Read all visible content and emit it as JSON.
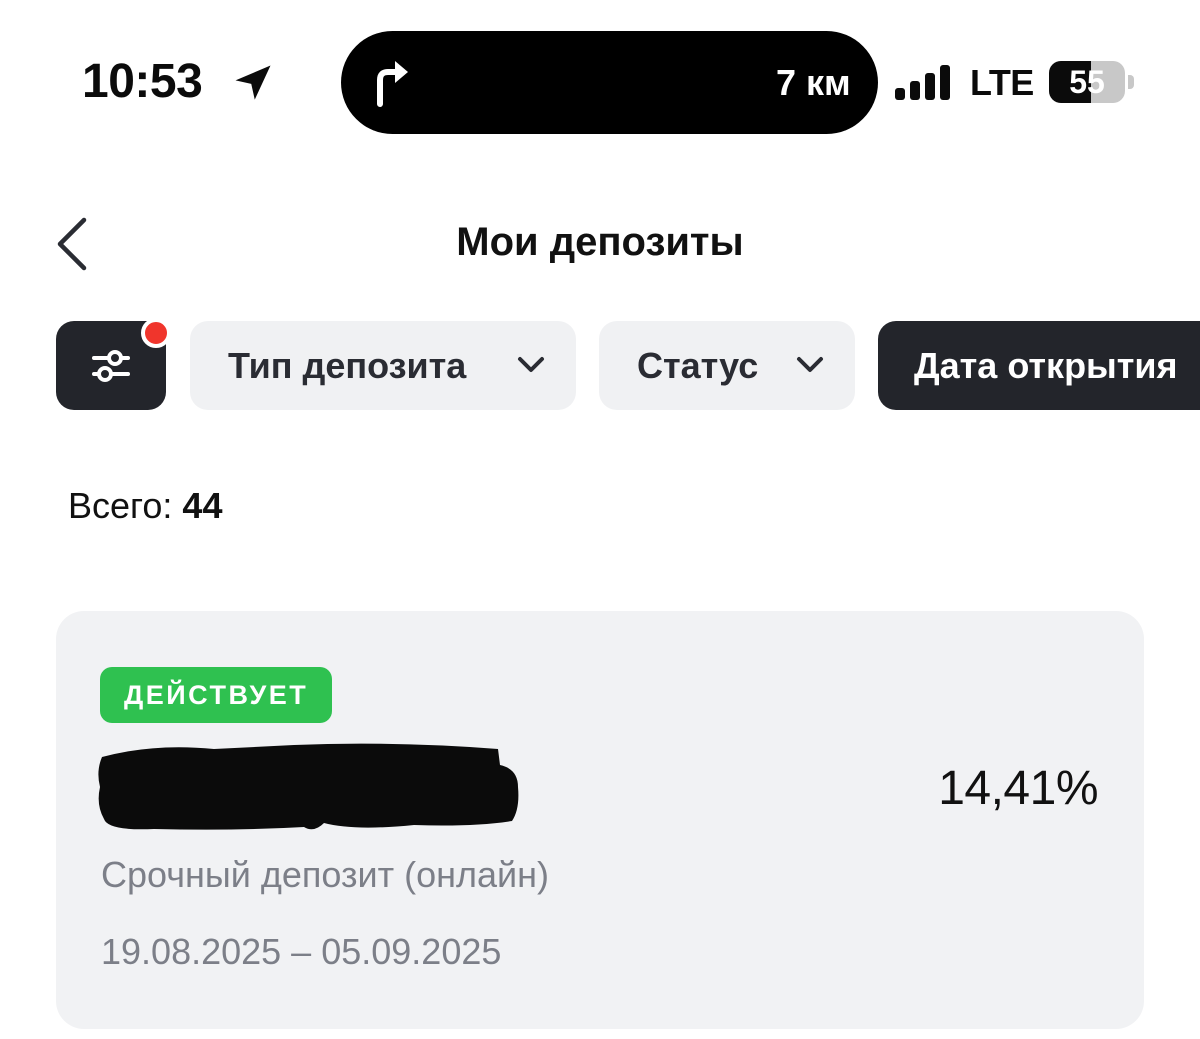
{
  "status_bar": {
    "time": "10:53",
    "location_icon": "location-arrow-icon",
    "navigation": {
      "icon": "turn-right-arrow-icon",
      "distance": "7 км"
    },
    "signal_icon": "cellular-signal-icon",
    "network": "LTE",
    "battery_level": "55",
    "battery_fraction": 0.55
  },
  "header": {
    "back_icon": "chevron-left-icon",
    "title": "Мои депозиты"
  },
  "filters": {
    "settings_icon": "sliders-icon",
    "has_notification_dot": true,
    "chips": [
      {
        "label": "Тип депозита",
        "icon": "chevron-down-icon",
        "selected": false
      },
      {
        "label": "Статус",
        "icon": "chevron-down-icon",
        "selected": false
      },
      {
        "label": "Дата открытия",
        "selected": true
      }
    ]
  },
  "summary": {
    "total_label": "Всего:",
    "total_value": "44"
  },
  "deposits": [
    {
      "status": "ДЕЙСТВУЕТ",
      "status_color": "#2fc150",
      "name_redacted": true,
      "rate": "14,41%",
      "type": "Срочный депозит (онлайн)",
      "period": "19.08.2025 – 05.09.2025"
    }
  ],
  "colors": {
    "accent_dark": "#23252b",
    "chip_light": "#f0f1f3",
    "notification": "#f0352c",
    "muted_text": "#7c7f88",
    "card_bg": "#f1f2f4"
  }
}
